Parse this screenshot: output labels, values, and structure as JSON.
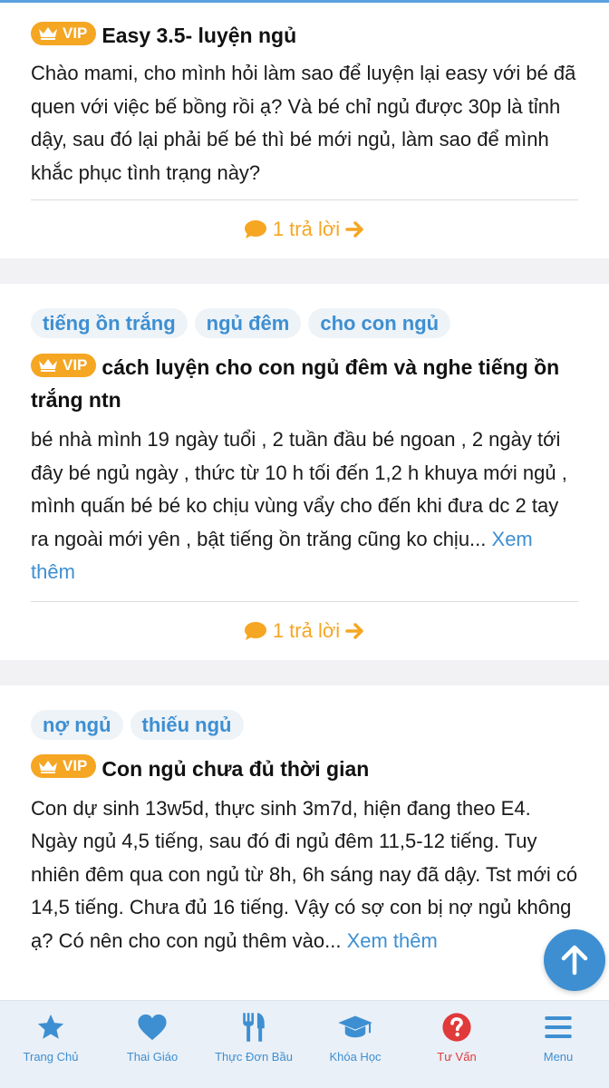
{
  "posts": [
    {
      "tags": [],
      "vip_label": "VIP",
      "title": "Easy 3.5- luyện ngủ",
      "body": "Chào mami, cho mình hỏi làm sao để luyện lại easy với bé đã quen với việc bế bồng rồi ạ? Và bé chỉ ngủ được 30p là tỉnh dậy, sau đó lại phải bế bé thì bé mới ngủ, làm sao để mình khắc phục tình trạng này?",
      "more": "",
      "reply": "1 trả lời"
    },
    {
      "tags": [
        "tiếng ồn trắng",
        "ngủ đêm",
        "cho con ngủ"
      ],
      "vip_label": "VIP",
      "title": "cách luyện cho con ngủ đêm và nghe tiếng ồn trắng ntn",
      "body": "bé nhà mình 19 ngày tuổi , 2 tuần đầu bé ngoan , 2 ngày tới đây bé ngủ ngày , thức từ 10 h tối đến 1,2 h khuya mới ngủ , mình quấn bé bé ko chịu vùng vẩy cho đến khi đưa dc 2 tay ra ngoài mới yên , bật tiếng ồn trăng cũng ko chịu...",
      "more": "Xem thêm",
      "reply": "1 trả lời"
    },
    {
      "tags": [
        "nợ ngủ",
        "thiếu ngủ"
      ],
      "vip_label": "VIP",
      "title": "Con ngủ chưa đủ thời gian",
      "body": "Con dự sinh 13w5d, thực sinh 3m7d, hiện đang theo E4. Ngày ngủ 4,5 tiếng, sau đó đi ngủ đêm 11,5-12 tiếng. Tuy nhiên đêm qua con ngủ từ 8h, 6h sáng nay đã dậy. Tst mới có 14,5 tiếng. Chưa đủ 16 tiếng. Vậy có sợ con bị nợ ngủ không ạ? Có nên cho con ngủ thêm vào...",
      "more": "Xem thêm",
      "reply": ""
    }
  ],
  "nav": [
    {
      "label": "Trang Chủ",
      "icon": "star-icon"
    },
    {
      "label": "Thai Giáo",
      "icon": "heart-icon"
    },
    {
      "label": "Thực Đơn Bầu",
      "icon": "utensils-icon"
    },
    {
      "label": "Khóa Học",
      "icon": "graduation-cap-icon"
    },
    {
      "label": "Tư Vấn",
      "icon": "question-circle-icon"
    },
    {
      "label": "Menu",
      "icon": "hamburger-menu-icon"
    }
  ],
  "colors": {
    "accent_blue": "#3d8fd2",
    "vip_orange": "#f5a623",
    "red": "#e03a3a"
  }
}
